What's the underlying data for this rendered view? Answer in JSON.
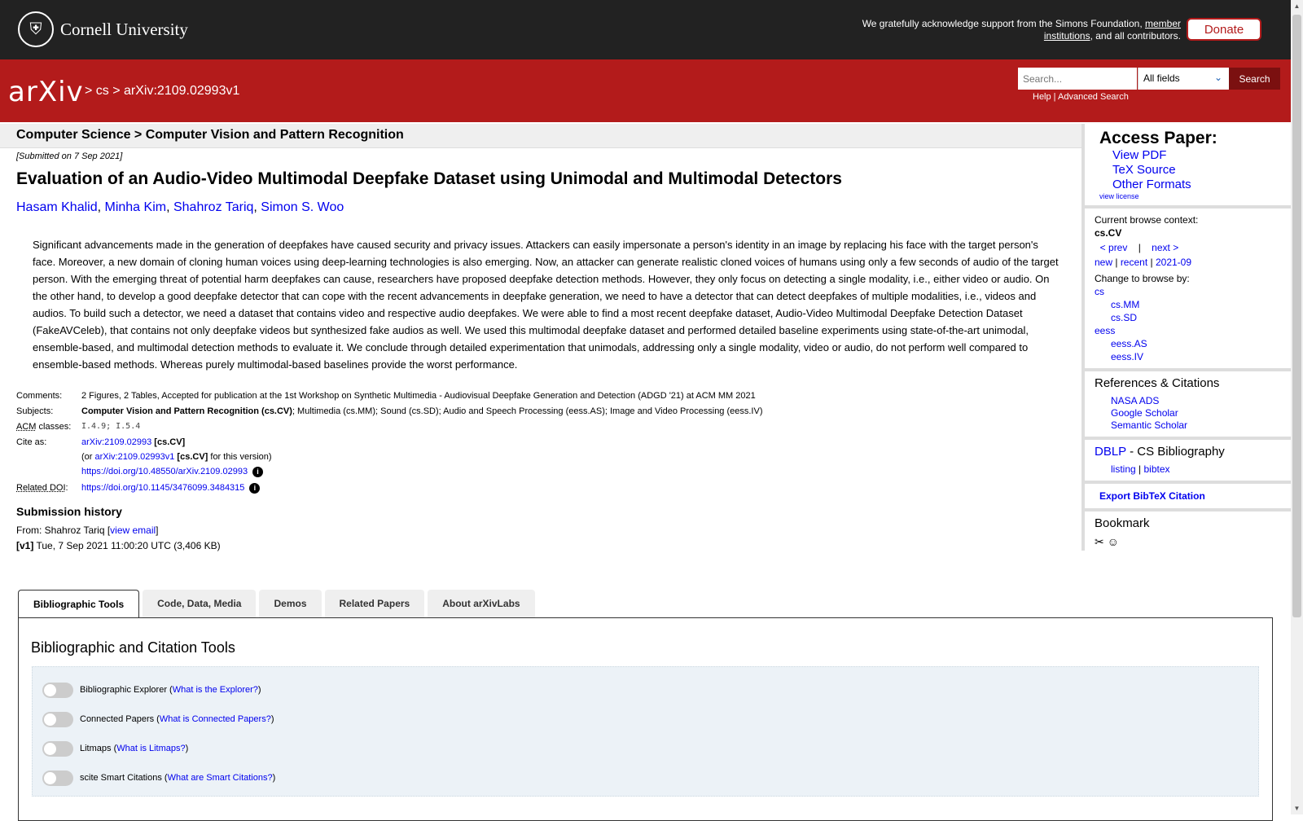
{
  "banner": {
    "university": "Cornell University",
    "support_prefix": "We gratefully acknowledge support from the Simons Foundation, ",
    "support_link": "member institutions",
    "support_suffix": ", and all contributors.",
    "donate": "Donate"
  },
  "header": {
    "logo": "arXiv",
    "crumb_cs": "cs",
    "crumb_id": "arXiv:2109.02993v1",
    "search_placeholder": "Search...",
    "field_select": "All fields",
    "search_button": "Search",
    "help": "Help",
    "advanced_search": "Advanced Search"
  },
  "subject_heading": "Computer Science > Computer Vision and Pattern Recognition",
  "paper": {
    "submitted": "[Submitted on 7 Sep 2021]",
    "title": "Evaluation of an Audio-Video Multimodal Deepfake Dataset using Unimodal and Multimodal Detectors",
    "authors": [
      "Hasam Khalid",
      "Minha Kim",
      "Shahroz Tariq",
      "Simon S. Woo"
    ],
    "abstract": "Significant advancements made in the generation of deepfakes have caused security and privacy issues. Attackers can easily impersonate a person's identity in an image by replacing his face with the target person's face. Moreover, a new domain of cloning human voices using deep-learning technologies is also emerging. Now, an attacker can generate realistic cloned voices of humans using only a few seconds of audio of the target person. With the emerging threat of potential harm deepfakes can cause, researchers have proposed deepfake detection methods. However, they only focus on detecting a single modality, i.e., either video or audio. On the other hand, to develop a good deepfake detector that can cope with the recent advancements in deepfake generation, we need to have a detector that can detect deepfakes of multiple modalities, i.e., videos and audios. To build such a detector, we need a dataset that contains video and respective audio deepfakes. We were able to find a most recent deepfake dataset, Audio-Video Multimodal Deepfake Detection Dataset (FakeAVCeleb), that contains not only deepfake videos but synthesized fake audios as well. We used this multimodal deepfake dataset and performed detailed baseline experiments using state-of-the-art unimodal, ensemble-based, and multimodal detection methods to evaluate it. We conclude through detailed experimentation that unimodals, addressing only a single modality, video or audio, do not perform well compared to ensemble-based methods. Whereas purely multimodal-based baselines provide the worst performance."
  },
  "meta": {
    "comments_label": "Comments:",
    "comments": "2 Figures, 2 Tables, Accepted for publication at the 1st Workshop on Synthetic Multimedia - Audiovisual Deepfake Generation and Detection (ADGD '21) at ACM MM 2021",
    "subjects_label": "Subjects:",
    "subjects_primary": "Computer Vision and Pattern Recognition (cs.CV)",
    "subjects_rest": "; Multimedia (cs.MM); Sound (cs.SD); Audio and Speech Processing (eess.AS); Image and Video Processing (eess.IV)",
    "acm_label": "ACM",
    "acm_suffix": " classes:",
    "acm_classes": "I.4.9; I.5.4",
    "cite_label": "Cite as:",
    "cite_id": "arXiv:2109.02993",
    "cite_cat": "[cs.CV]",
    "cite_or": "(or ",
    "cite_version": "arXiv:2109.02993v1",
    "cite_version_cat": "[cs.CV]",
    "cite_version_suffix": " for this version)",
    "doi": "https://doi.org/10.48550/arXiv.2109.02993",
    "related_doi_label": "Related DOI",
    "related_doi": "https://doi.org/10.1145/3476099.3484315",
    "info_glyph": "i"
  },
  "history": {
    "title": "Submission history",
    "from_prefix": "From: Shahroz Tariq [",
    "view_email": "view email",
    "from_suffix": "]",
    "v1_label": "[v1]",
    "v1_text": " Tue, 7 Sep 2021 11:00:20 UTC (3,406 KB)"
  },
  "sidebar": {
    "access_title": "Access Paper:",
    "view_pdf": "View PDF",
    "tex_source": "TeX Source",
    "other_formats": "Other Formats",
    "view_license": "view license",
    "context_label": "Current browse context:",
    "context_value": "cs.CV",
    "prev": "< prev",
    "sep": "|",
    "next": "next >",
    "new": "new",
    "recent": "recent",
    "month": "2021-09",
    "change_label": "Change to browse by:",
    "browse": [
      "cs",
      "cs.MM",
      "cs.SD",
      "eess",
      "eess.AS",
      "eess.IV"
    ],
    "refs_title": "References & Citations",
    "nasa": "NASA ADS",
    "google": "Google Scholar",
    "semantic": "Semantic Scholar",
    "dblp": "DBLP",
    "dblp_suffix": " - CS Bibliography",
    "listing": "listing",
    "bibtex": "bibtex",
    "export": "Export BibTeX Citation",
    "bookmark": "Bookmark"
  },
  "tabs": [
    "Bibliographic Tools",
    "Code, Data, Media",
    "Demos",
    "Related Papers",
    "About arXivLabs"
  ],
  "panel": {
    "title": "Bibliographic and Citation Tools",
    "tools": [
      {
        "name": "Bibliographic Explorer",
        "link": "What is the Explorer?"
      },
      {
        "name": "Connected Papers",
        "link": "What is Connected Papers?"
      },
      {
        "name": "Litmaps",
        "link": "What is Litmaps?"
      },
      {
        "name": "scite Smart Citations",
        "link": "What are Smart Citations?"
      }
    ]
  }
}
